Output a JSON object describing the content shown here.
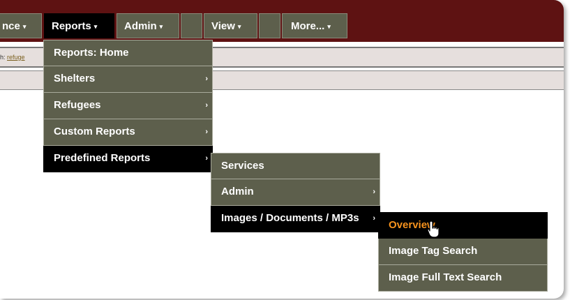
{
  "menubar": {
    "items": [
      {
        "label": "nce",
        "arrow": "▾"
      },
      {
        "label": "Reports",
        "arrow": "▾"
      },
      {
        "label": "Admin",
        "arrow": "▾"
      },
      {
        "label": "",
        "arrow": ""
      },
      {
        "label": "View",
        "arrow": "▾"
      },
      {
        "label": "",
        "arrow": ""
      },
      {
        "label": "More...",
        "arrow": "▾"
      }
    ]
  },
  "breadcrumb": {
    "prefix": "h:",
    "link": "refuge"
  },
  "reports_menu": {
    "items": [
      {
        "label": "Reports: Home",
        "submenu": ""
      },
      {
        "label": "Shelters",
        "submenu": "›"
      },
      {
        "label": "Refugees",
        "submenu": "›"
      },
      {
        "label": "Custom Reports",
        "submenu": "›"
      },
      {
        "label": "Predefined Reports",
        "submenu": "›"
      }
    ]
  },
  "predefined_menu": {
    "items": [
      {
        "label": "Services",
        "submenu": ""
      },
      {
        "label": "Admin",
        "submenu": "›"
      },
      {
        "label": "Images / Documents / MP3s",
        "submenu": "›"
      }
    ]
  },
  "images_menu": {
    "items": [
      {
        "label": "Overview",
        "submenu": ""
      },
      {
        "label": "Image Tag Search",
        "submenu": ""
      },
      {
        "label": "Image Full Text Search",
        "submenu": ""
      }
    ]
  },
  "colors": {
    "menubar_bg": "#5e1212",
    "menu_item_bg": "#5d5f4c",
    "active_bg": "#000000",
    "highlight_text": "#f7931e",
    "strip_bg": "#e6dfdd"
  },
  "icons": {
    "submenu": "chevron-right-icon",
    "dropdown": "chevron-down-icon",
    "cursor": "hand-pointer-icon"
  }
}
